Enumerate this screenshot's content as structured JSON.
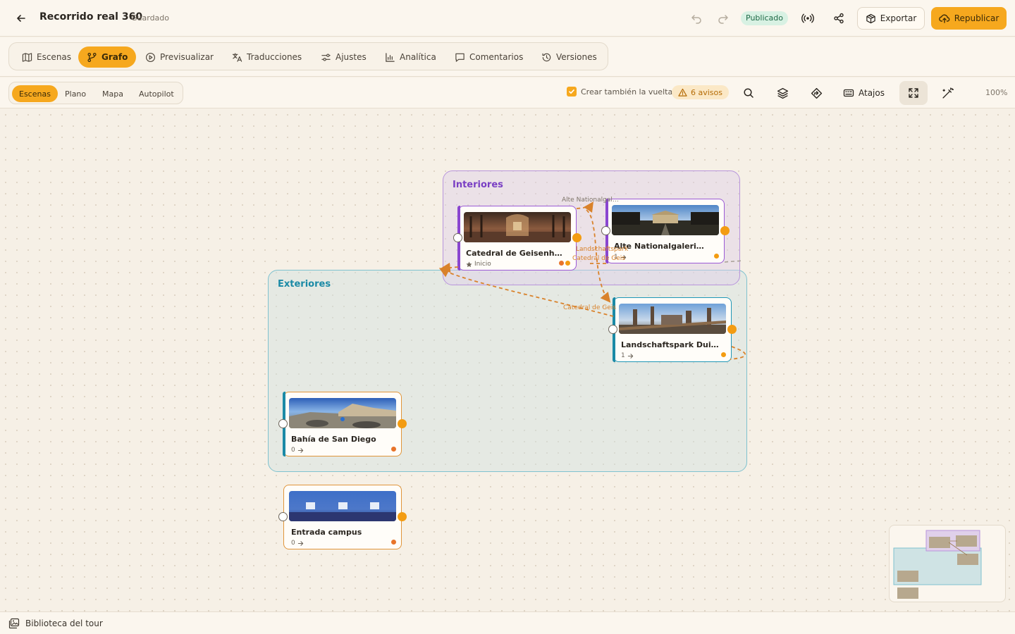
{
  "header": {
    "title": "Recorrido real 360",
    "save_status": "Guardado",
    "publish_status": "Publicado",
    "export_label": "Exportar",
    "republish_label": "Republicar"
  },
  "tabs": [
    {
      "label": "Escenas",
      "icon": "map-icon"
    },
    {
      "label": "Grafo",
      "icon": "graph-icon",
      "active": true
    },
    {
      "label": "Previsualizar",
      "icon": "play-icon"
    },
    {
      "label": "Traducciones",
      "icon": "translate-icon"
    },
    {
      "label": "Ajustes",
      "icon": "sliders-icon"
    },
    {
      "label": "Analítica",
      "icon": "bar-chart-icon"
    },
    {
      "label": "Comentarios",
      "icon": "comment-icon"
    },
    {
      "label": "Versiones",
      "icon": "history-icon"
    }
  ],
  "view_modes": [
    {
      "label": "Escenas",
      "active": true
    },
    {
      "label": "Plano"
    },
    {
      "label": "Mapa"
    },
    {
      "label": "Autopilot"
    }
  ],
  "toolbar": {
    "return_checkbox_label": "Crear también la vuelta",
    "return_checked": true,
    "warnings_label": "6 avisos",
    "shortcuts_label": "Atajos",
    "zoom": "100%"
  },
  "groups": {
    "interiores": "Interiores",
    "exteriores": "Exteriores"
  },
  "nodes": {
    "catedral": {
      "name": "Catedral de Geisenh…",
      "sub": "Inicio"
    },
    "alte": {
      "name": "Alte Nationalgaleri…",
      "sub": "1"
    },
    "landschaft": {
      "name": "Landschaftspark Dui…",
      "sub": "1"
    },
    "bahia": {
      "name": "Bahía de San Diego",
      "sub": "0"
    },
    "entrada": {
      "name": "Entrada campus",
      "sub": "0"
    }
  },
  "edge_labels": {
    "alte": "Alte Nationalgal…",
    "landschaft": "Landschaftspark",
    "catedral_a": "Catedral de Geis",
    "catedral_b": "Catedral de Geis"
  },
  "footer": {
    "library_label": "Biblioteca del tour"
  },
  "colors": {
    "accent": "#f6a81e",
    "interiores": "#7a3fc4",
    "exteriores": "#1b8aa6",
    "published": "#1f6b47"
  }
}
